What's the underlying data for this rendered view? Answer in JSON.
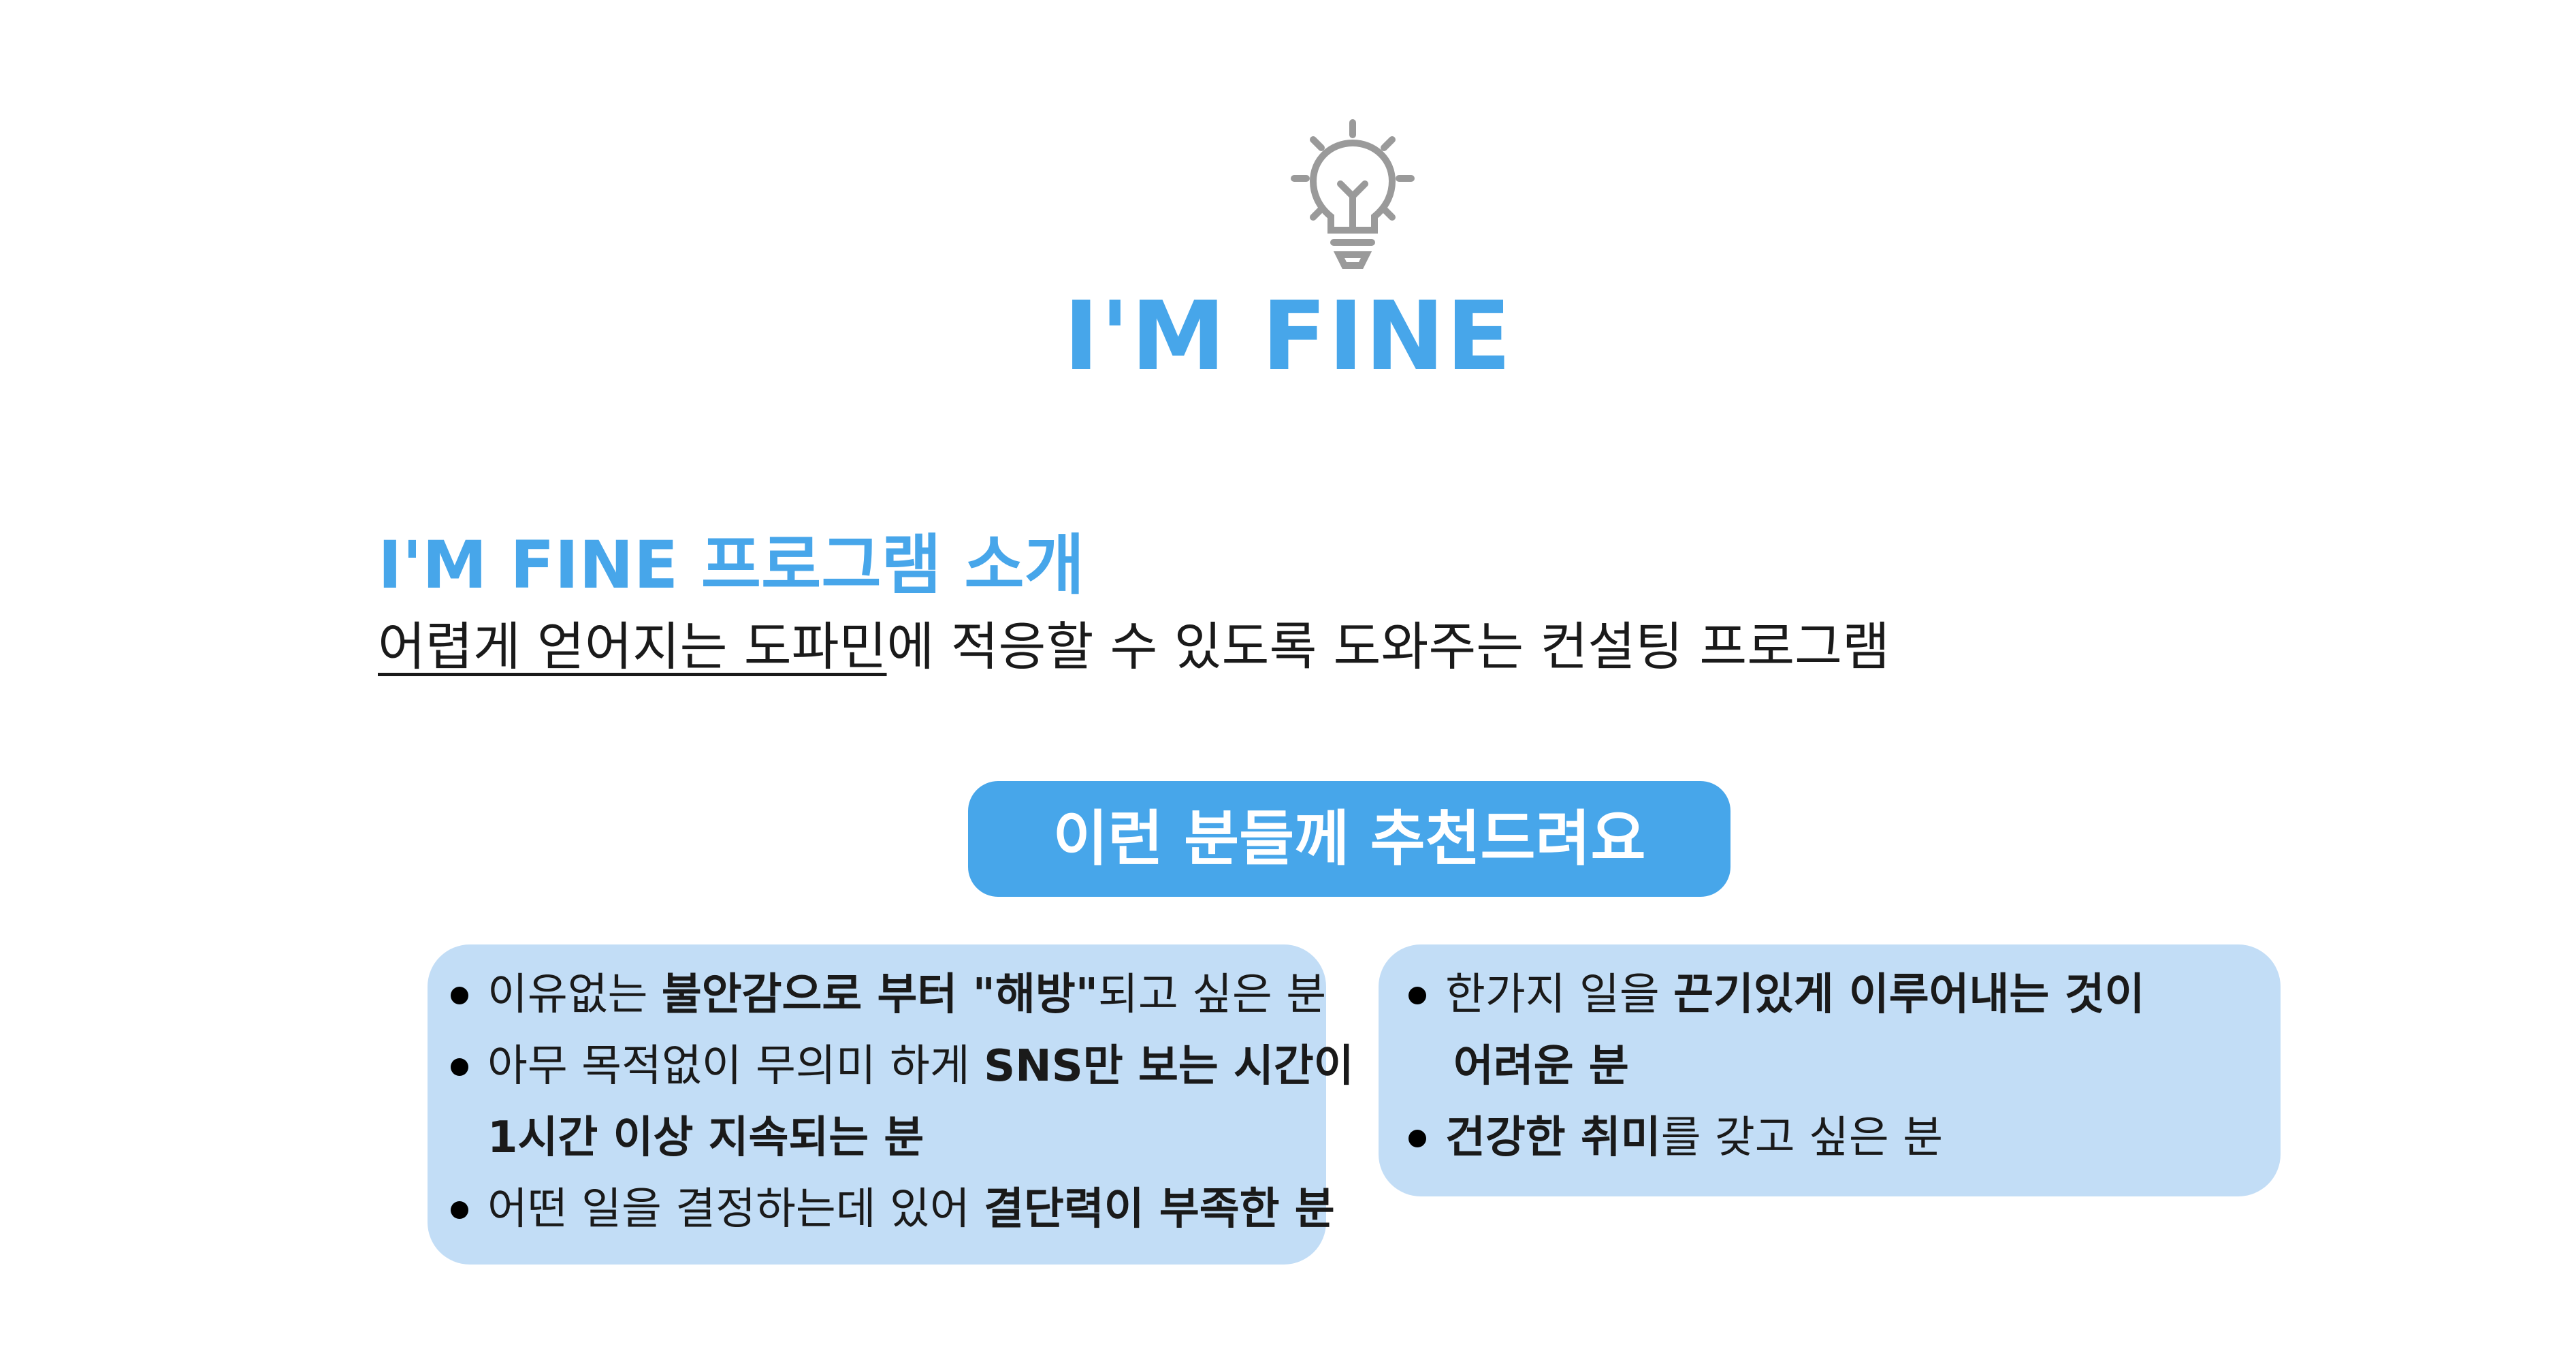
{
  "header": {
    "icon": "lightbulb-icon",
    "title": "I'M FINE"
  },
  "intro": {
    "heading": "I'M FINE 프로그램 소개",
    "sub_underlined": "어렵게 얻어지는 도파민",
    "sub_rest": "에 적응할 수 있도록 도와주는 컨설팅 프로그램"
  },
  "recommend": {
    "label": "이런 분들께 추천드려요"
  },
  "left_card": {
    "items": [
      {
        "t1": "이유없는 ",
        "b1": "불안감으로 부터 \"해방\"",
        "t2": "되고 싶은 분"
      },
      {
        "t1": "아무 목적없이 무의미 하게 ",
        "b1": "SNS만 보는 시간이",
        "b2": "1시간 이상 지속되는 분"
      },
      {
        "t1": "어떤 일을 결정하는데 있어 ",
        "b1": "결단력이 부족한 분"
      }
    ]
  },
  "right_card": {
    "items": [
      {
        "t1": "한가지 일을 ",
        "b1": "끈기있게 이루어내는 것이",
        "b2": "어려운 분"
      },
      {
        "b1": "건강한 취미",
        "t2": "를 갖고 싶은 분"
      }
    ]
  },
  "colors": {
    "accent": "#47a6ea",
    "card_bg": "#c2ddf6",
    "text": "#1a1a1a"
  }
}
